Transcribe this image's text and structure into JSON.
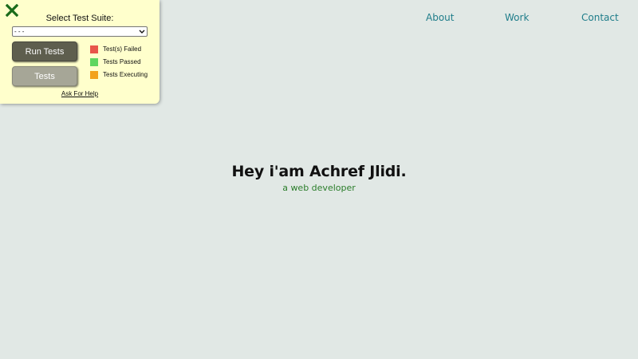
{
  "nav": {
    "items": [
      {
        "label": "About"
      },
      {
        "label": "Work"
      },
      {
        "label": "Contact"
      }
    ]
  },
  "hero": {
    "title": "Hey i'am Achref Jlidi.",
    "subtitle": "a web developer"
  },
  "test_panel": {
    "title": "Select Test Suite:",
    "select_value": "- - -",
    "run_button_label": "Run Tests",
    "tests_button_label": "Tests",
    "legend": [
      {
        "label": "Test(s) Failed",
        "color": "#e8564a"
      },
      {
        "label": "Tests Passed",
        "color": "#5fd65f"
      },
      {
        "label": "Tests Executing",
        "color": "#f2a21d"
      }
    ],
    "help_link_label": "Ask For Help",
    "close_icon": "close-x-icon",
    "close_icon_color": "#1a6b1a"
  },
  "colors": {
    "background": "#e1e8e5",
    "nav_link": "#1f7d8a",
    "subtitle": "#2a7d2a",
    "panel_background": "#ffffcc"
  }
}
